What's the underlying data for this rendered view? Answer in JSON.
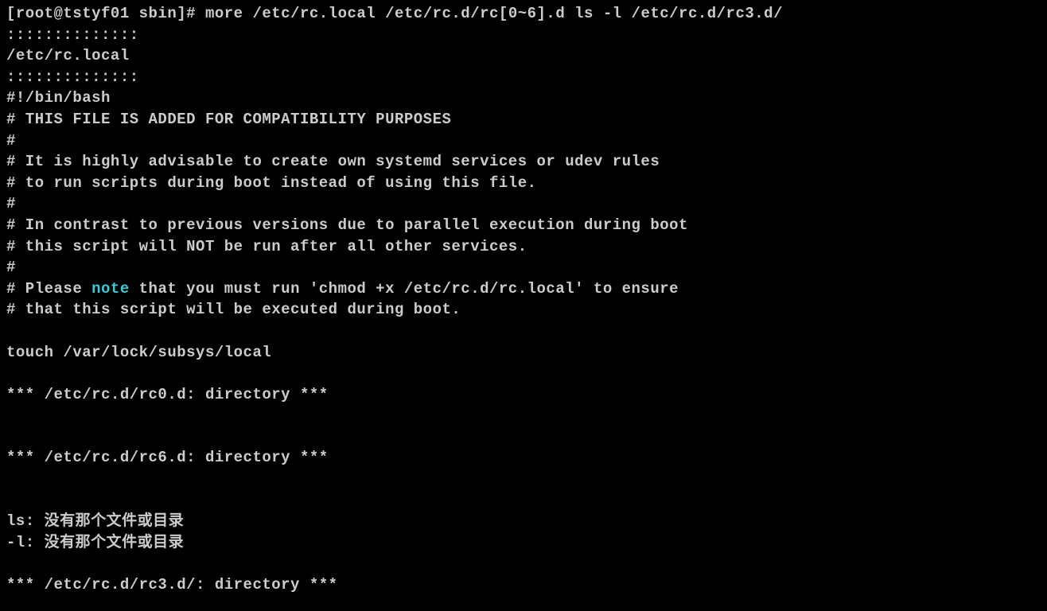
{
  "terminal": {
    "prompt": "[root@tstyf01 sbin]# ",
    "command": "more /etc/rc.local /etc/rc.d/rc[0~6].d ls -l /etc/rc.d/rc3.d/",
    "sep1": "::::::::::::::",
    "filename": "/etc/rc.local",
    "sep2": "::::::::::::::",
    "shebang": "#!/bin/bash",
    "line1": "# THIS FILE IS ADDED FOR COMPATIBILITY PURPOSES",
    "line2": "#",
    "line3": "# It is highly advisable to create own systemd services or udev rules",
    "line4": "# to run scripts during boot instead of using this file.",
    "line5": "#",
    "line6": "# In contrast to previous versions due to parallel execution during boot",
    "line7": "# this script will NOT be run after all other services.",
    "line8": "#",
    "line9a": "# Please ",
    "line9_note": "note",
    "line9b": " that you must run 'chmod +x /etc/rc.d/rc.local' to ensure",
    "line10": "# that this script will be executed during boot.",
    "touch": "touch /var/lock/subsys/local",
    "dir0": "*** /etc/rc.d/rc0.d: directory ***",
    "dir6": "*** /etc/rc.d/rc6.d: directory ***",
    "err_ls": "ls: 没有那个文件或目录",
    "err_l": "-l: 没有那个文件或目录",
    "dir3": "*** /etc/rc.d/rc3.d/: directory ***"
  }
}
